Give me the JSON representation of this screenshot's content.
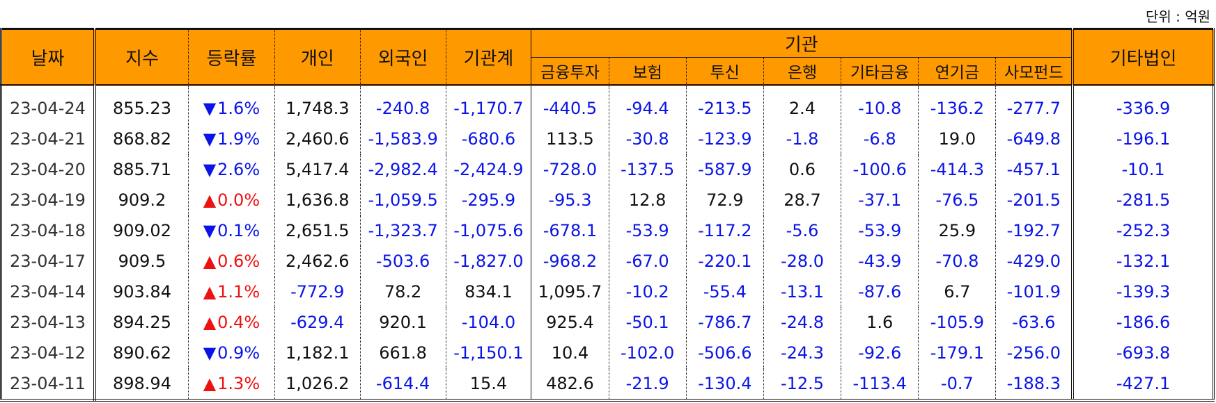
{
  "unit_label": "단위 : 억원",
  "headers": {
    "date": "날짜",
    "index": "지수",
    "rate": "등락률",
    "individual": "개인",
    "foreign": "외국인",
    "inst_total": "기관계",
    "inst_group": "기관",
    "sub": [
      "금융투자",
      "보험",
      "투신",
      "은행",
      "기타금융",
      "연기금",
      "사모펀드"
    ],
    "other_corp": "기타법인"
  },
  "colors": {
    "header_bg": "#ff9900",
    "negative": "#0a14e8",
    "up": "#ee1111",
    "down": "#0a14e8"
  },
  "rows": [
    {
      "date": "23-04-24",
      "index": "855.23",
      "dir": "down",
      "rate": "1.6%",
      "vals": [
        "1,748.3",
        "-240.8",
        "-1,170.7",
        "-440.5",
        "-94.4",
        "-213.5",
        "2.4",
        "-10.8",
        "-136.2",
        "-277.7",
        "-336.9"
      ]
    },
    {
      "date": "23-04-21",
      "index": "868.82",
      "dir": "down",
      "rate": "1.9%",
      "vals": [
        "2,460.6",
        "-1,583.9",
        "-680.6",
        "113.5",
        "-30.8",
        "-123.9",
        "-1.8",
        "-6.8",
        "19.0",
        "-649.8",
        "-196.1"
      ]
    },
    {
      "date": "23-04-20",
      "index": "885.71",
      "dir": "down",
      "rate": "2.6%",
      "vals": [
        "5,417.4",
        "-2,982.4",
        "-2,424.9",
        "-728.0",
        "-137.5",
        "-587.9",
        "0.6",
        "-100.6",
        "-414.3",
        "-457.1",
        "-10.1"
      ]
    },
    {
      "date": "23-04-19",
      "index": "909.2",
      "dir": "up",
      "rate": "0.0%",
      "vals": [
        "1,636.8",
        "-1,059.5",
        "-295.9",
        "-95.3",
        "12.8",
        "72.9",
        "28.7",
        "-37.1",
        "-76.5",
        "-201.5",
        "-281.5"
      ]
    },
    {
      "date": "23-04-18",
      "index": "909.02",
      "dir": "down",
      "rate": "0.1%",
      "vals": [
        "2,651.5",
        "-1,323.7",
        "-1,075.6",
        "-678.1",
        "-53.9",
        "-117.2",
        "-5.6",
        "-53.9",
        "25.9",
        "-192.7",
        "-252.3"
      ]
    },
    {
      "date": "23-04-17",
      "index": "909.5",
      "dir": "up",
      "rate": "0.6%",
      "vals": [
        "2,462.6",
        "-503.6",
        "-1,827.0",
        "-968.2",
        "-67.0",
        "-220.1",
        "-28.0",
        "-43.9",
        "-70.8",
        "-429.0",
        "-132.1"
      ]
    },
    {
      "date": "23-04-14",
      "index": "903.84",
      "dir": "up",
      "rate": "1.1%",
      "vals": [
        "-772.9",
        "78.2",
        "834.1",
        "1,095.7",
        "-10.2",
        "-55.4",
        "-13.1",
        "-87.6",
        "6.7",
        "-101.9",
        "-139.3"
      ]
    },
    {
      "date": "23-04-13",
      "index": "894.25",
      "dir": "up",
      "rate": "0.4%",
      "vals": [
        "-629.4",
        "920.1",
        "-104.0",
        "925.4",
        "-50.1",
        "-786.7",
        "-24.8",
        "1.6",
        "-105.9",
        "-63.6",
        "-186.6"
      ]
    },
    {
      "date": "23-04-12",
      "index": "890.62",
      "dir": "down",
      "rate": "0.9%",
      "vals": [
        "1,182.1",
        "661.8",
        "-1,150.1",
        "10.4",
        "-102.0",
        "-506.6",
        "-24.3",
        "-92.6",
        "-179.1",
        "-256.0",
        "-693.8"
      ]
    },
    {
      "date": "23-04-11",
      "index": "898.94",
      "dir": "up",
      "rate": "1.3%",
      "vals": [
        "1,026.2",
        "-614.4",
        "15.4",
        "482.6",
        "-21.9",
        "-130.4",
        "-12.5",
        "-113.4",
        "-0.7",
        "-188.3",
        "-427.1"
      ]
    }
  ]
}
